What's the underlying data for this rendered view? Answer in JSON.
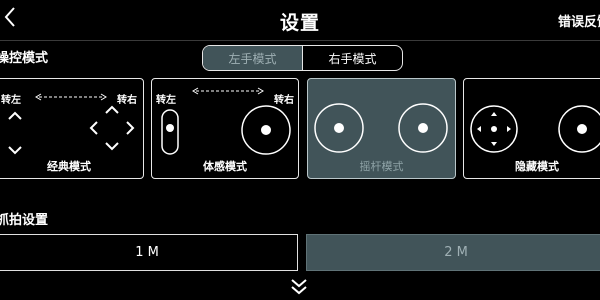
{
  "header": {
    "back_icon": "chevron-left-icon",
    "title": "设置",
    "feedback_label": "错误反馈"
  },
  "control": {
    "section_label": "操控模式",
    "hand_modes": [
      {
        "label": "左手模式",
        "active": true
      },
      {
        "label": "右手模式",
        "active": false
      }
    ],
    "modes": [
      {
        "label": "经典模式",
        "turn_left": "转左",
        "turn_right": "转右",
        "selected": false
      },
      {
        "label": "体感模式",
        "turn_left": "转左",
        "turn_right": "转右",
        "selected": false
      },
      {
        "label": "摇杆模式",
        "selected": true
      },
      {
        "label": "隐藏模式",
        "selected": false
      }
    ]
  },
  "snapshot": {
    "section_label": "抓拍设置",
    "resolutions": [
      {
        "label": "1 M",
        "selected": false
      },
      {
        "label": "2 M",
        "selected": true
      }
    ],
    "expand_icon": "double-chevron-down-icon"
  },
  "colors": {
    "background": "#000000",
    "selected_fill": "#415459",
    "border": "#e8e8e8"
  }
}
